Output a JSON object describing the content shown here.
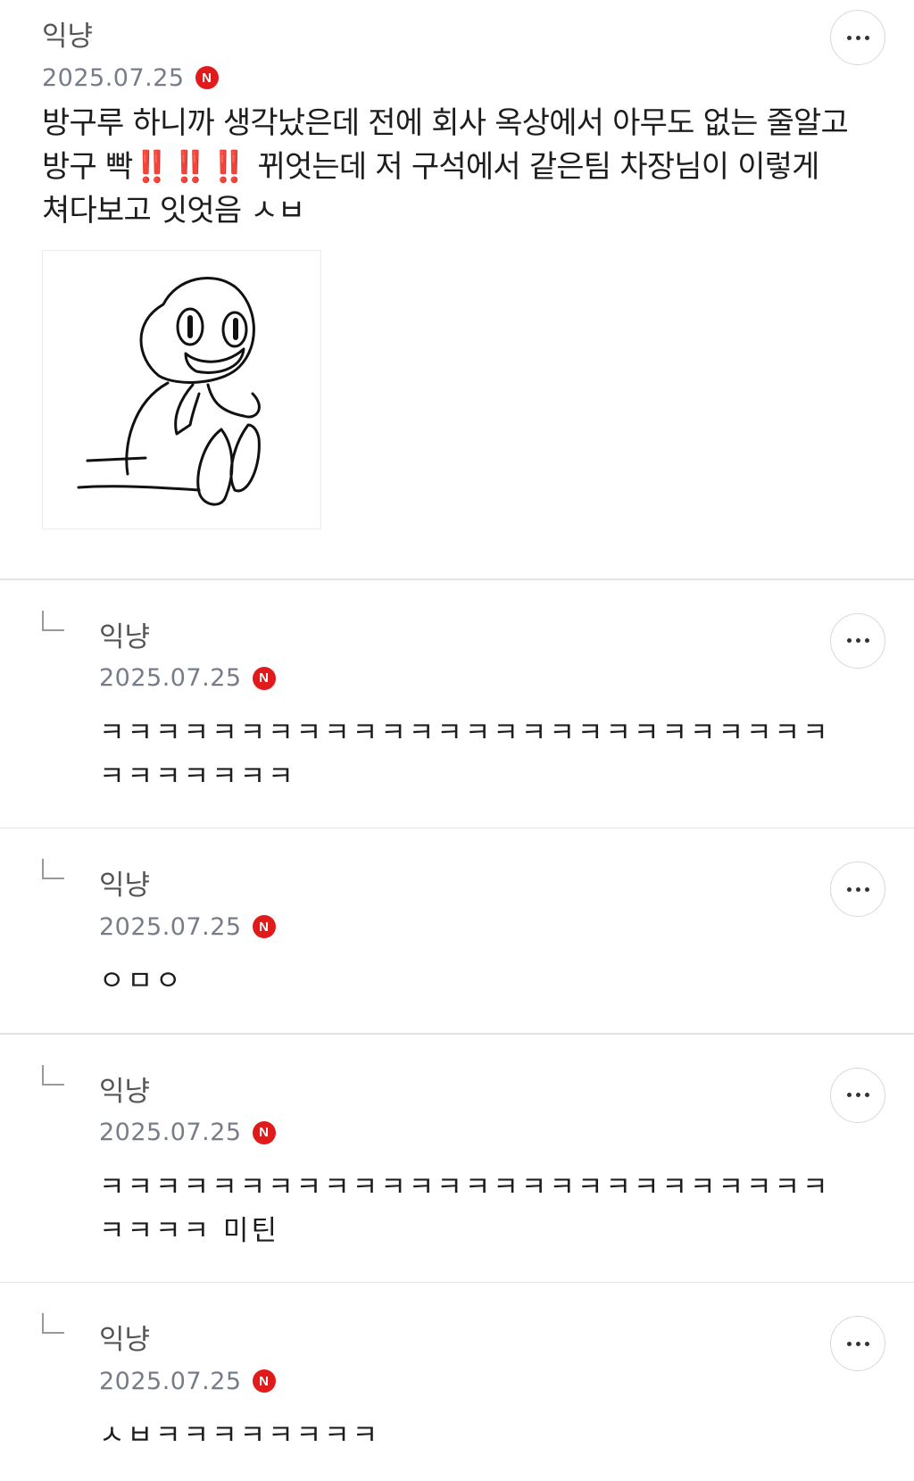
{
  "post": {
    "author": "익냥",
    "date": "2025.07.25",
    "badge": "N",
    "text_before": "방구루 하니까 생각났은데 전에 회사 옥상에서 아무도 없는 줄알고 방구 빡",
    "emphasis": "‼️‼️‼️",
    "text_after": " 뀌엇는데 저 구석에서 같은팀 차장님이 이렇게 쳐다보고 잇엇음 ㅅㅂ"
  },
  "comments": [
    {
      "author": "익냥",
      "date": "2025.07.25",
      "badge": "N",
      "text": "ㅋㅋㅋㅋㅋㅋㅋㅋㅋㅋㅋㅋㅋㅋㅋㅋㅋㅋㅋㅋㅋㅋㅋㅋㅋㅋㅋㅋㅋㅋㅋㅋㅋ"
    },
    {
      "author": "익냥",
      "date": "2025.07.25",
      "badge": "N",
      "text": "ㅇㅁㅇ"
    },
    {
      "author": "익냥",
      "date": "2025.07.25",
      "badge": "N",
      "text": "ㅋㅋㅋㅋㅋㅋㅋㅋㅋㅋㅋㅋㅋㅋㅋㅋㅋㅋㅋㅋㅋㅋㅋㅋㅋㅋㅋㅋㅋㅋ 미틴"
    },
    {
      "author": "익냥",
      "date": "2025.07.25",
      "badge": "N",
      "text": "ㅅㅂㅋㅋㅋㅋㅋㅋㅋㅋ"
    }
  ],
  "icons": {
    "more": "more-horizontal-icon",
    "reply": "reply-arrow-icon",
    "new": "new-badge-icon"
  },
  "colors": {
    "badge": "#e01b1b",
    "date": "#777d88",
    "divider": "#e4e4e4"
  }
}
